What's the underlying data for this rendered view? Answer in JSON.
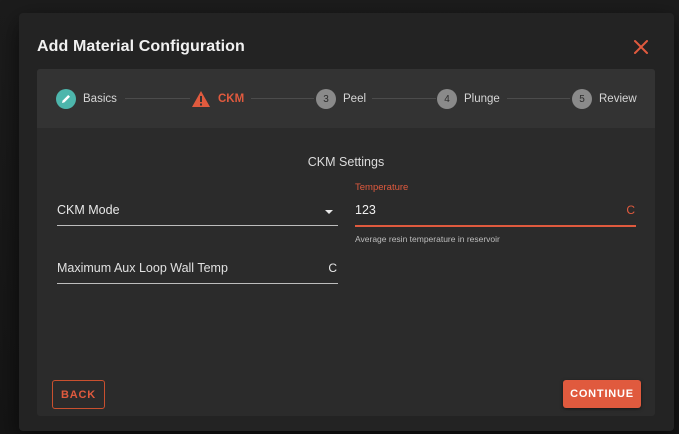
{
  "dialog": {
    "title": "Add Material Configuration"
  },
  "colors": {
    "accent": "#e05a3e",
    "done": "#4db6ac",
    "inactive": "#8a8a8a"
  },
  "stepper": {
    "steps": [
      {
        "label": "Basics",
        "state": "completed",
        "icon": "pencil-icon"
      },
      {
        "label": "CKM",
        "state": "error",
        "icon": "warning-icon"
      },
      {
        "label": "Peel",
        "number": "3",
        "state": "pending"
      },
      {
        "label": "Plunge",
        "number": "4",
        "state": "pending"
      },
      {
        "label": "Review",
        "number": "5",
        "state": "pending"
      }
    ]
  },
  "section": {
    "title": "CKM Settings"
  },
  "fields": {
    "ckm_mode": {
      "label": "CKM Mode",
      "value": ""
    },
    "temperature": {
      "label": "Temperature",
      "value": "123",
      "unit": "C",
      "helper": "Average resin temperature in reservoir"
    },
    "max_aux_loop_wall_temp": {
      "label": "Maximum Aux Loop Wall Temp",
      "unit": "C"
    }
  },
  "actions": {
    "back": "BACK",
    "continue": "CONTINUE"
  }
}
